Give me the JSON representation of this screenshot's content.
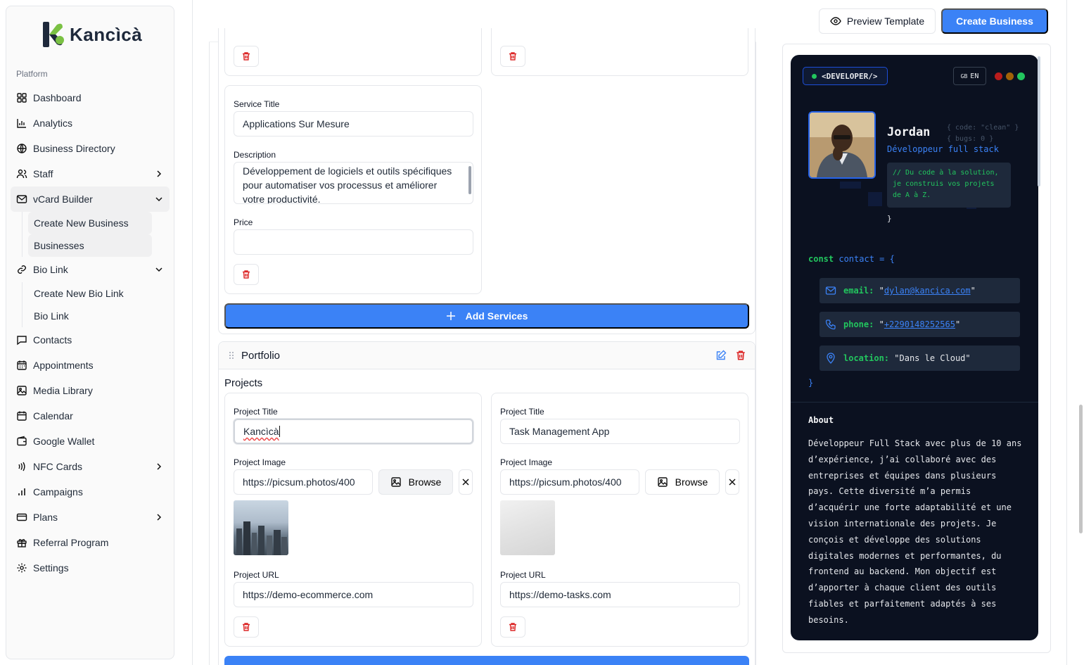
{
  "brand": {
    "name": "Kancìcà"
  },
  "sidebar": {
    "section_label": "Platform",
    "items": [
      {
        "label": "Dashboard"
      },
      {
        "label": "Analytics"
      },
      {
        "label": "Business Directory"
      },
      {
        "label": "Staff"
      },
      {
        "label": "vCard Builder"
      },
      {
        "label": "Bio Link"
      },
      {
        "label": "Contacts"
      },
      {
        "label": "Appointments"
      },
      {
        "label": "Media Library"
      },
      {
        "label": "Calendar"
      },
      {
        "label": "Google Wallet"
      },
      {
        "label": "NFC Cards"
      },
      {
        "label": "Campaigns"
      },
      {
        "label": "Plans"
      },
      {
        "label": "Referral Program"
      },
      {
        "label": "Settings"
      }
    ],
    "vcard_sub": [
      "Create New Business",
      "Businesses"
    ],
    "biolink_sub": [
      "Create New Bio Link",
      "Bio Link"
    ]
  },
  "topbar": {
    "preview_label": "Preview Template",
    "create_label": "Create Business"
  },
  "services": {
    "service_title_label": "Service Title",
    "service_title_value": "Applications Sur Mesure",
    "description_label": "Description",
    "description_value": "Développement de logiciels et outils spécifiques pour automatiser vos processus et améliorer votre productivité.",
    "price_label": "Price",
    "price_value": "",
    "add_label": "Add Services"
  },
  "portfolio": {
    "section_title": "Portfolio",
    "projects_label": "Projects",
    "project_title_label": "Project Title",
    "project_image_label": "Project Image",
    "project_url_label": "Project URL",
    "browse_label": "Browse",
    "projects": [
      {
        "title": "Kancìcà",
        "image": "https://picsum.photos/400",
        "url": "https://demo-ecommerce.com"
      },
      {
        "title": "Task Management App",
        "image": "https://picsum.photos/400",
        "url": "https://demo-tasks.com"
      }
    ]
  },
  "preview": {
    "badge": "<DEVELOPER/>",
    "lang": "EN",
    "lang_flag": "GB",
    "name": "Jordan",
    "role": "Développeur full stack",
    "code_comment_1": "{ code: \"clean\" }",
    "code_comment_2": "{ bugs: 0 }",
    "tagline": "// Du code à la solution, je construis vos projets de A à Z.",
    "closing_brace": "}",
    "const_kw": "const",
    "const_name": "contact",
    "const_eq": "= {",
    "email_key": "email:",
    "email_val": "dylan@kancica.com",
    "phone_key": "phone:",
    "phone_val": "+2290148252565",
    "location_key": "location:",
    "location_val": "\"Dans le Cloud\"",
    "end_brace": "}",
    "about_title": "About",
    "about_text": "Développeur Full Stack avec plus de 10 ans d’expérience, j’ai collaboré avec des entreprises et équipes dans plusieurs pays. Cette diversité m’a permis d’acquérir une forte adaptabilité et une vision internationale des projets. Je conçois et développe des solutions digitales modernes et performantes, du frontend au backend. Mon objectif est d’apporter à chaque client des outils fiables et parfaitement adaptés à ses besoins."
  }
}
